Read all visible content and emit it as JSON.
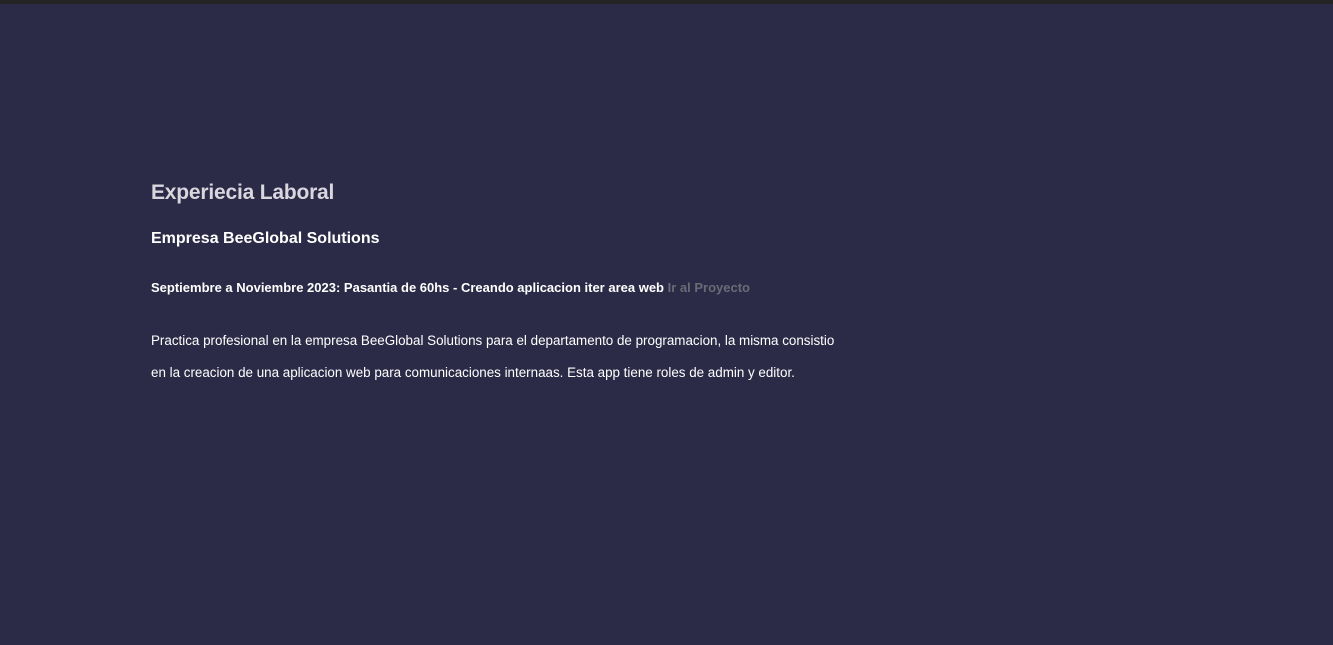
{
  "experience": {
    "title": "Experiecia Laboral",
    "company": "Empresa BeeGlobal Solutions",
    "job_line": "Septiembre a Noviembre 2023: Pasantia de 60hs - Creando aplicacion iter area web",
    "project_link_label": "Ir al Proyecto",
    "description_lines": [
      "Practica profesional en la empresa BeeGlobal Solutions para el departamento de programacion, la misma consistio",
      "en la creacion de una aplicacion web para comunicaciones internaas. Esta app tiene roles de admin y editor."
    ]
  },
  "colors": {
    "background": "#2c2b47",
    "title_text": "#d9d6df",
    "body_text": "#ffffff",
    "link_text": "#6b6a75",
    "top_strip": "#242424"
  }
}
